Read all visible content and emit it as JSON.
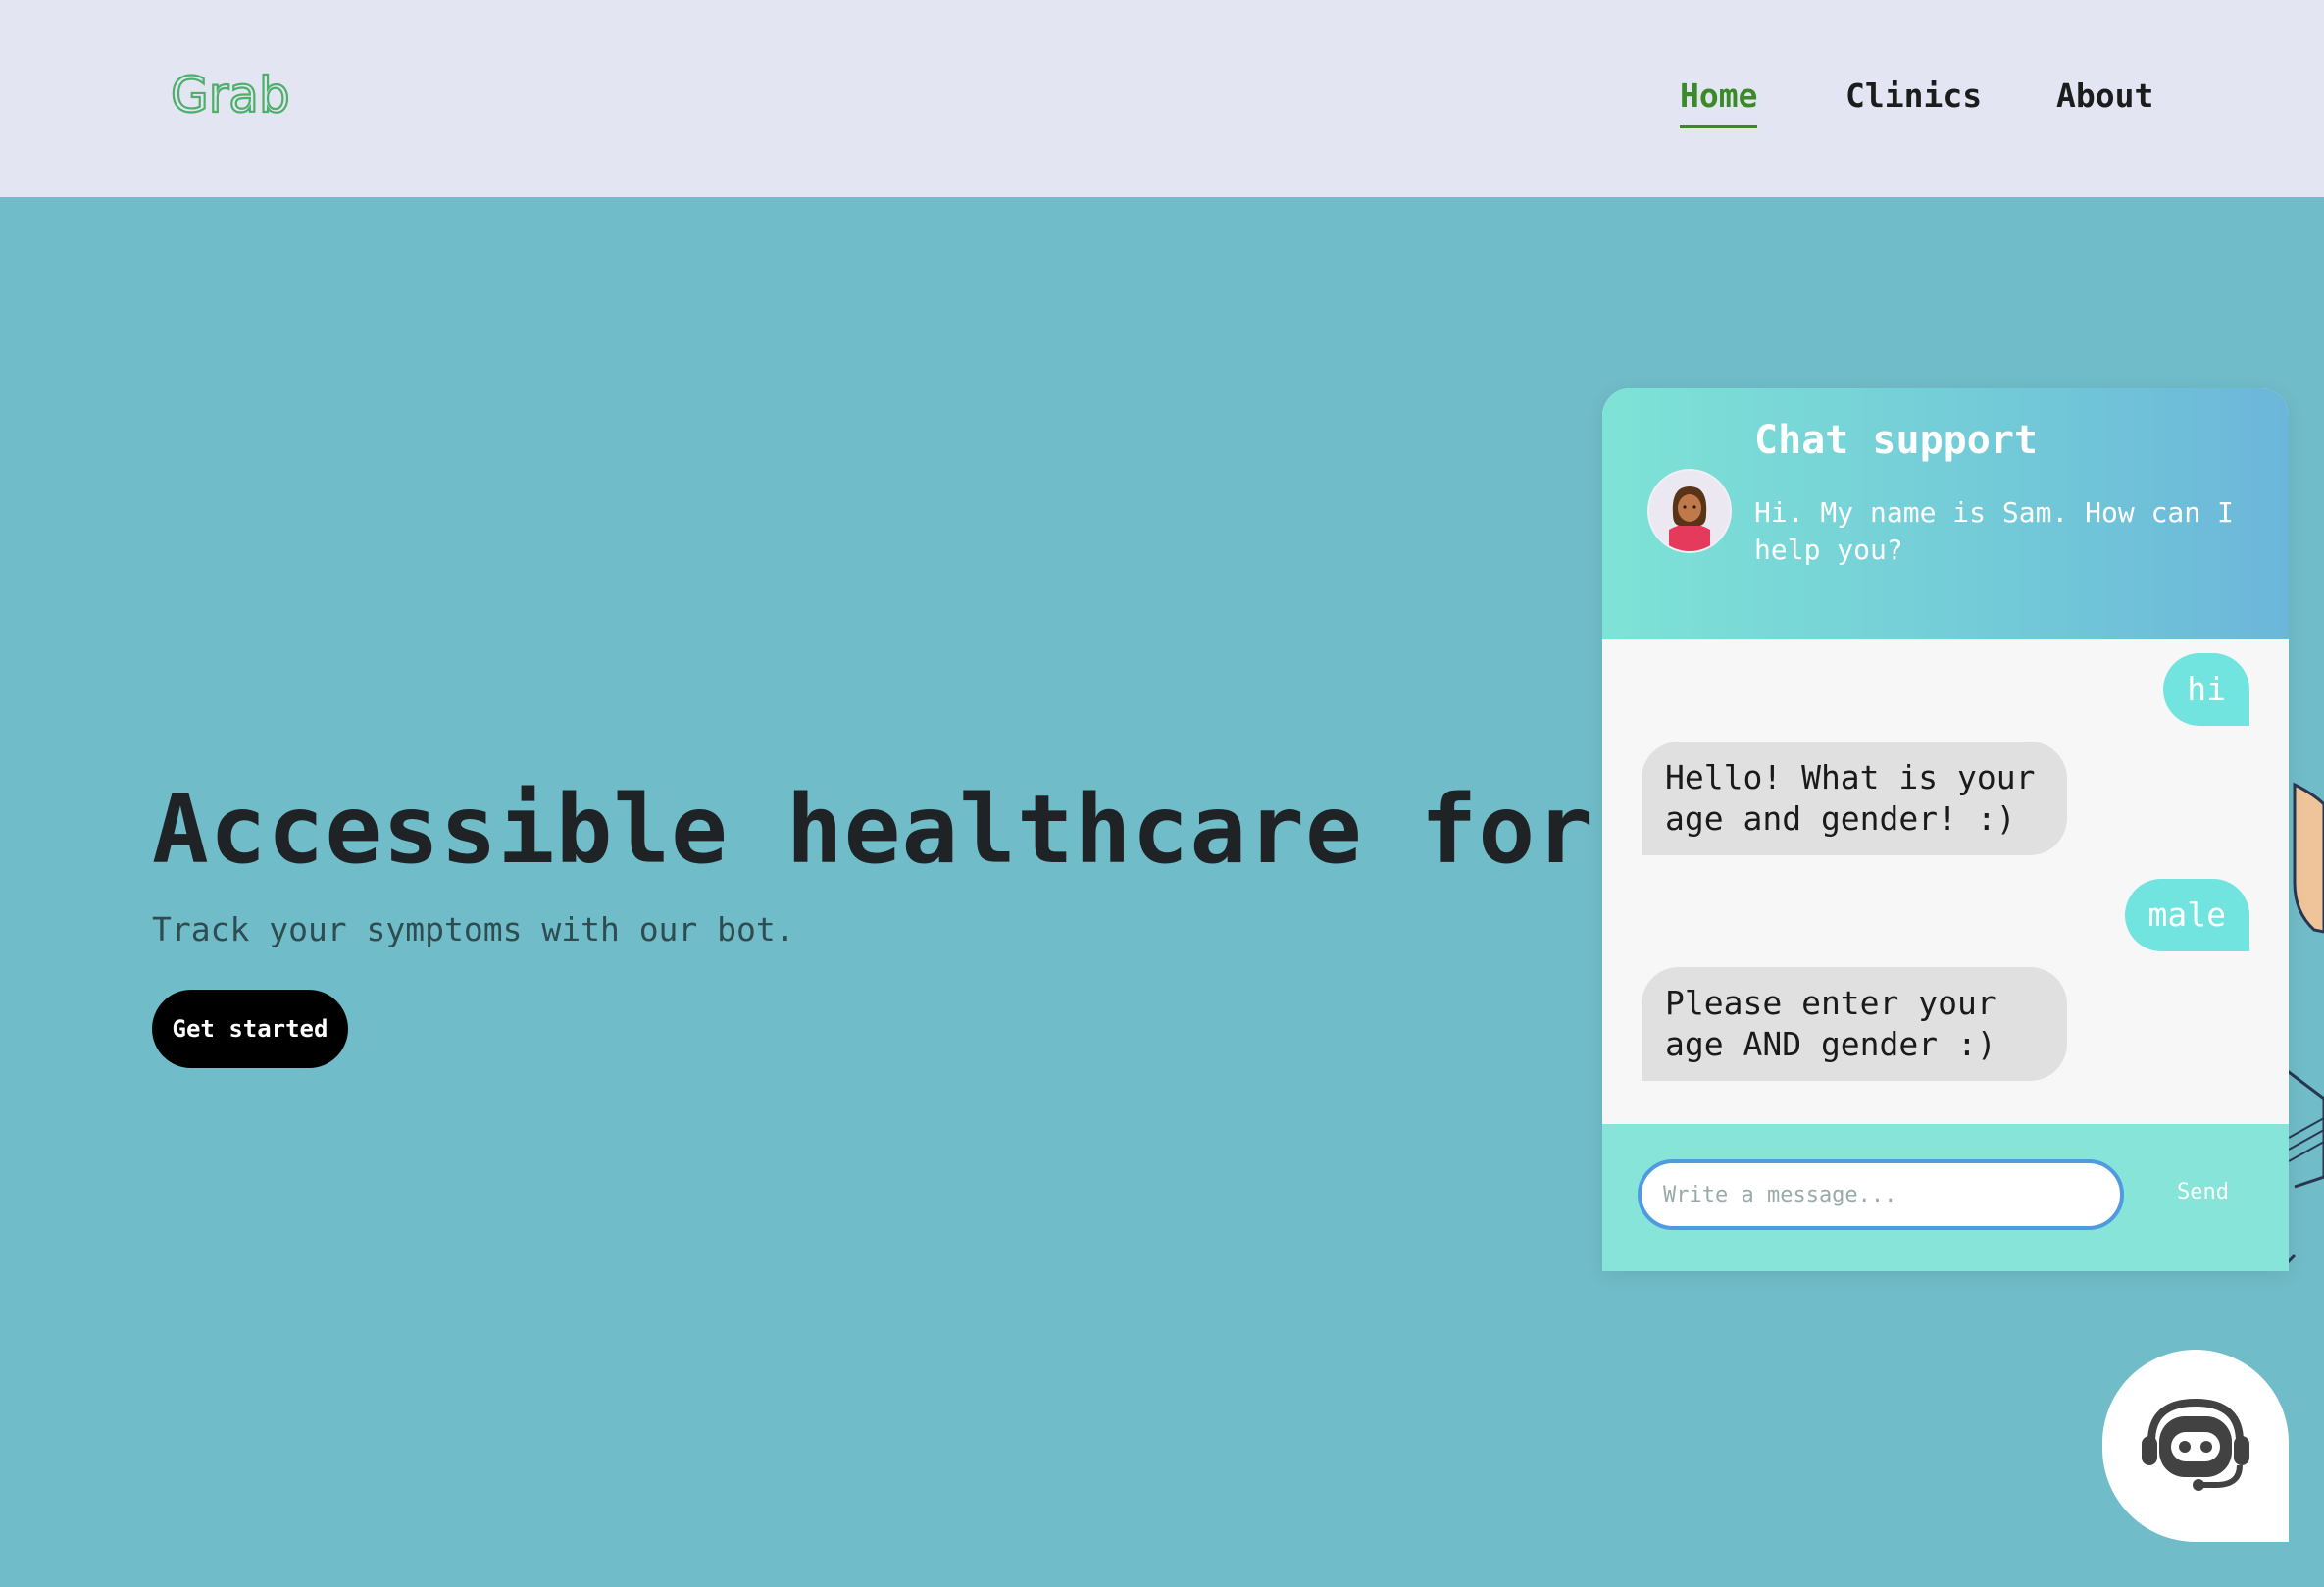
{
  "navbar": {
    "logo_text": "Grab",
    "links": [
      {
        "label": "Home",
        "active": true
      },
      {
        "label": "Clinics",
        "active": false
      },
      {
        "label": "About",
        "active": false
      }
    ],
    "accent_color": "#3a8a2a"
  },
  "hero": {
    "title": "Accessible healthcare for e",
    "subtitle": "Track your symptoms with our bot.",
    "cta_label": "Get started"
  },
  "chat": {
    "title": "Chat support",
    "greeting": "Hi. My name is Sam. How can I help you?",
    "avatar_icon": "female-agent-avatar-icon",
    "messages": [
      {
        "from": "user",
        "text": "hi"
      },
      {
        "from": "bot",
        "text": "Hello! What is your age and gender! :)"
      },
      {
        "from": "user",
        "text": "male"
      },
      {
        "from": "bot",
        "text": "Please enter your age AND gender :)"
      }
    ],
    "input_placeholder": "Write a message...",
    "send_label": "Send"
  },
  "fab": {
    "icon": "support-bot-icon"
  },
  "colors": {
    "page_background": "#70bcc8",
    "navbar_background": "#e3e6f2",
    "user_bubble": "#72e4df",
    "bot_bubble": "#e0e0e0"
  }
}
